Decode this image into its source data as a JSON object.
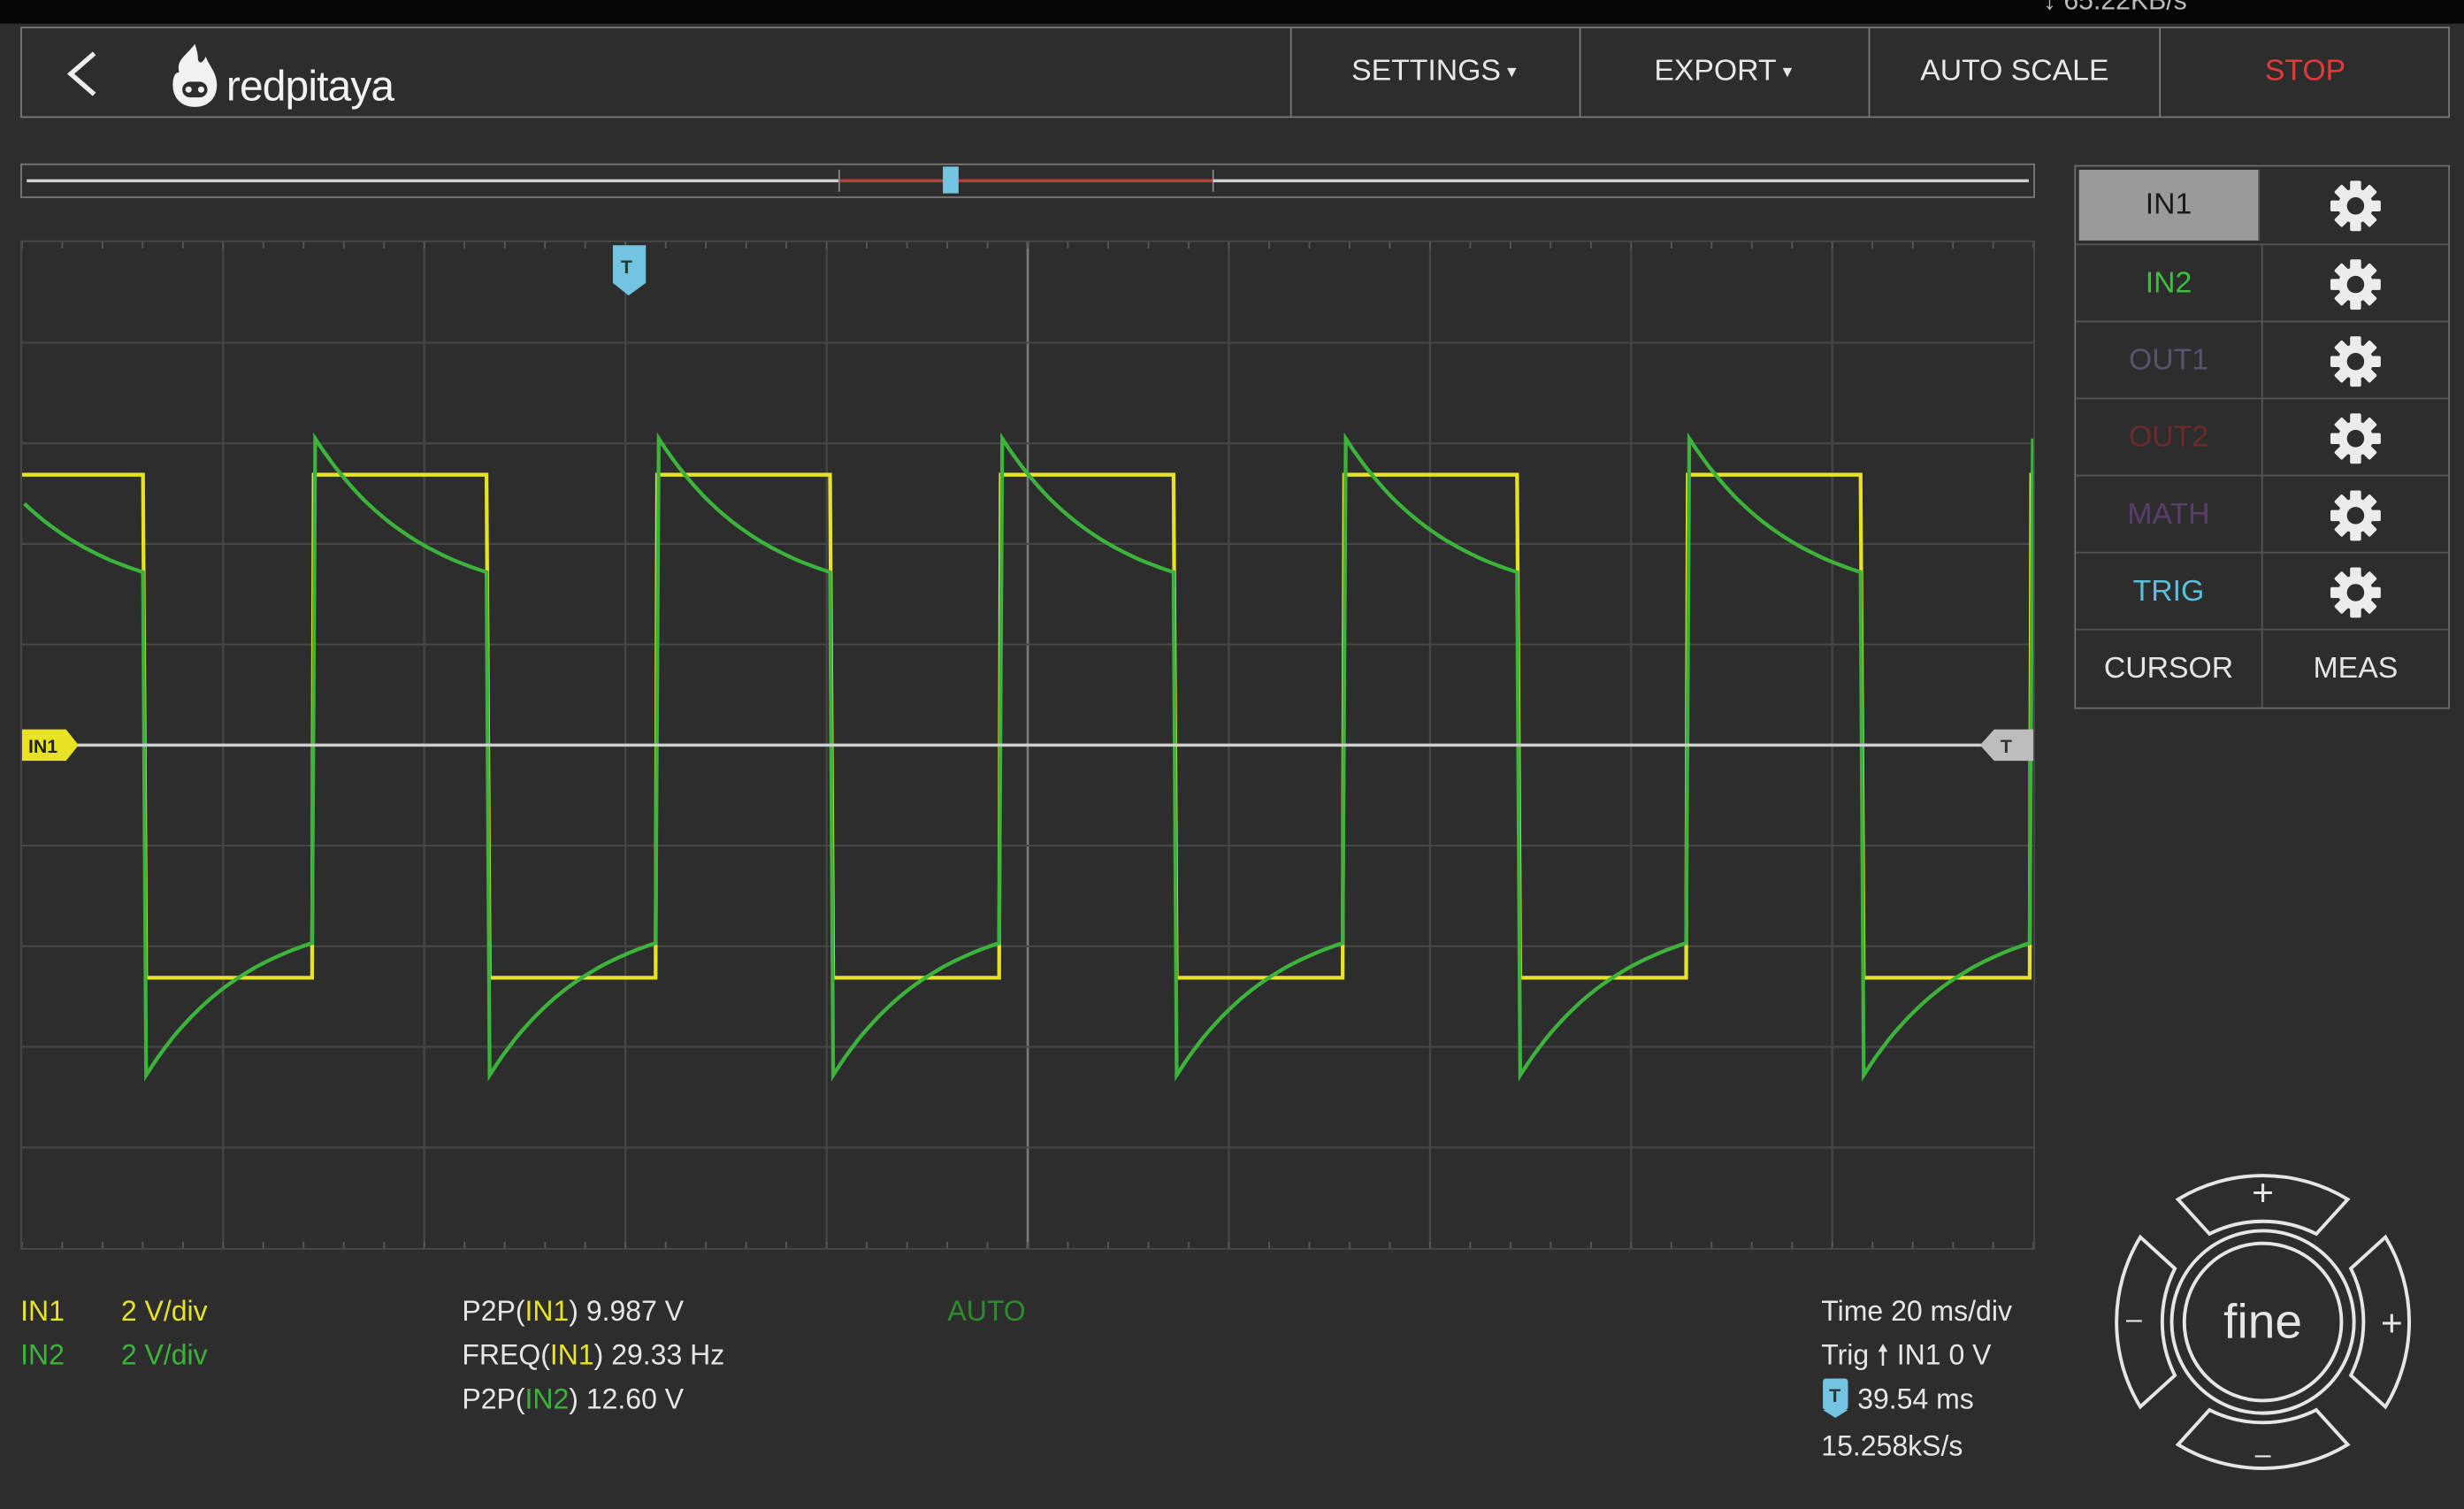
{
  "status": {
    "rate": "65.22KB/s"
  },
  "header": {
    "brand": "redpitaya",
    "menu": [
      {
        "label": "SETTINGS",
        "caret": true
      },
      {
        "label": "EXPORT",
        "caret": true
      },
      {
        "label": "AUTO SCALE",
        "caret": false
      },
      {
        "label": "STOP",
        "caret": false
      }
    ]
  },
  "channels_panel": {
    "rows": [
      {
        "label": "IN1",
        "color": "#1a1a1a",
        "selected": true
      },
      {
        "label": "IN2",
        "color": "#3fbf3f"
      },
      {
        "label": "OUT1",
        "color": "#55556e"
      },
      {
        "label": "OUT2",
        "color": "#6e2a2a"
      },
      {
        "label": "MATH",
        "color": "#5a3f6a"
      },
      {
        "label": "TRIG",
        "color": "#5bc0de"
      }
    ],
    "cursor": "CURSOR",
    "meas": "MEAS"
  },
  "plot": {
    "in1_marker": "IN1",
    "trig_marker": "T",
    "colors": {
      "in1": "#e8e224",
      "in2": "#3cb43c",
      "trig": "#73c4e0",
      "grid": "#474747"
    }
  },
  "scales": [
    {
      "channel": "IN1",
      "value": "2 V/div",
      "color": "#e8e224"
    },
    {
      "channel": "IN2",
      "value": "2 V/div",
      "color": "#3cb43c"
    }
  ],
  "measurements": [
    {
      "prefix": "P2P(",
      "channel": "IN1",
      "suffix": ") 9.987 V",
      "color": "#e8e224"
    },
    {
      "prefix": "FREQ(",
      "channel": "IN1",
      "suffix": ") 29.33 Hz",
      "color": "#e8e224"
    },
    {
      "prefix": "P2P(",
      "channel": "IN2",
      "suffix": ") 12.60 V",
      "color": "#3cb43c"
    }
  ],
  "mode": "AUTO",
  "timebase": {
    "time": "Time 20 ms/div",
    "trig_prefix": "Trig",
    "trig_value": "IN1 0 V",
    "offset": "39.54 ms",
    "rate": "15.258kS/s"
  },
  "wheel": {
    "center": "fine",
    "plus": "+",
    "minus": "–"
  }
}
